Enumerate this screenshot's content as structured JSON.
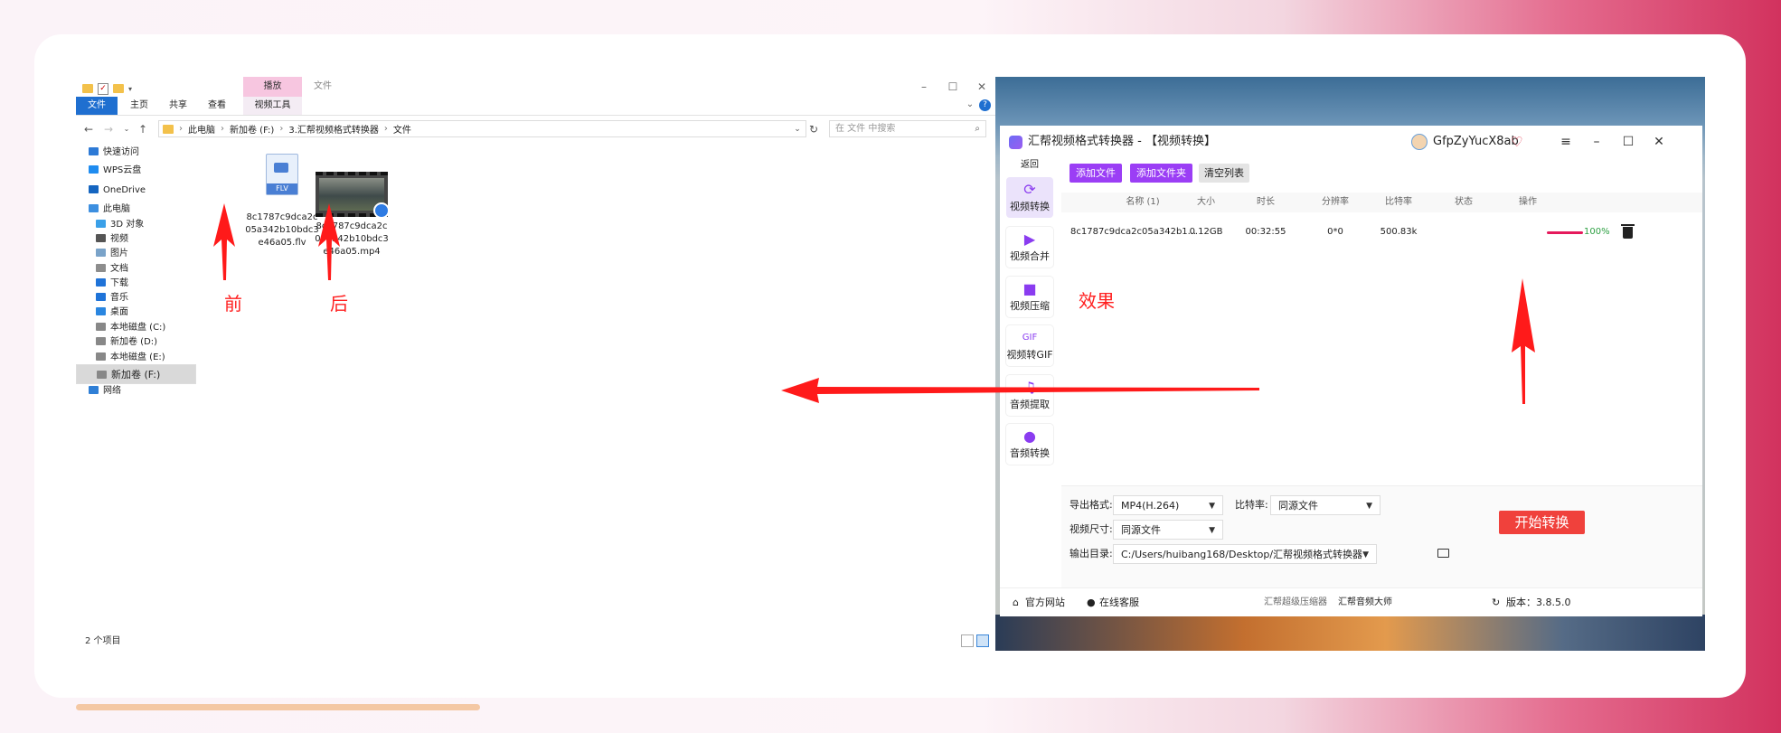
{
  "explorer": {
    "ribbon_tool_tab": "播放",
    "title": "文件",
    "ribbon_tabs": [
      "文件",
      "主页",
      "共享",
      "查看",
      "视频工具"
    ],
    "breadcrumb": [
      "此电脑",
      "新加卷 (F:)",
      "3.汇帮视频格式转换器",
      "文件"
    ],
    "search_placeholder": "在 文件 中搜索",
    "nav_items": [
      {
        "label": "快速访问",
        "icon": "star-icon",
        "color": "#2d7ad6"
      },
      {
        "label": "WPS云盘",
        "icon": "cloud-icon",
        "color": "#1f8cf0"
      },
      {
        "label": "OneDrive",
        "icon": "cloud-icon",
        "color": "#1565c0"
      },
      {
        "label": "此电脑",
        "icon": "computer-icon",
        "color": "#3d8fe0"
      },
      {
        "label": "3D 对象",
        "icon": "cube-icon",
        "color": "#3aa0e8"
      },
      {
        "label": "视频",
        "icon": "film-icon",
        "color": "#555555"
      },
      {
        "label": "图片",
        "icon": "picture-icon",
        "color": "#7aa3c9"
      },
      {
        "label": "文档",
        "icon": "document-icon",
        "color": "#8d8d8d"
      },
      {
        "label": "下载",
        "icon": "download-icon",
        "color": "#1f73d8"
      },
      {
        "label": "音乐",
        "icon": "music-icon",
        "color": "#1f73d8"
      },
      {
        "label": "桌面",
        "icon": "desktop-icon",
        "color": "#2a86e0"
      },
      {
        "label": "本地磁盘 (C:)",
        "icon": "drive-icon",
        "color": "#888888"
      },
      {
        "label": "新加卷 (D:)",
        "icon": "drive-icon",
        "color": "#888888"
      },
      {
        "label": "本地磁盘 (E:)",
        "icon": "drive-icon",
        "color": "#888888"
      },
      {
        "label": "新加卷 (F:)",
        "icon": "drive-icon",
        "color": "#888888"
      },
      {
        "label": "网络",
        "icon": "network-icon",
        "color": "#2f7fd6"
      }
    ],
    "files": [
      {
        "name": "8c1787c9dca2c05a342b10bdc3e46a05.flv",
        "badge": "FLV"
      },
      {
        "name": "8c1787c9dca2c05a342b10bdc3e46a05.mp4"
      }
    ],
    "status": "2 个项目"
  },
  "annotations": {
    "before": "前",
    "after": "后",
    "effect": "效果"
  },
  "converter": {
    "title": "汇帮视频格式转换器 - 【视频转换】",
    "user": "GfpZyYucX8ab",
    "back": "返回",
    "sidebar": [
      "视频转换",
      "视频合并",
      "视频压缩",
      "视频转GIF",
      "音频提取",
      "音频转换"
    ],
    "toolbar": {
      "add_file": "添加文件",
      "add_folder": "添加文件夹",
      "clear": "清空列表"
    },
    "table_headers": [
      "名称 (1)",
      "大小",
      "时长",
      "分辨率",
      "比特率",
      "状态",
      "操作"
    ],
    "row": {
      "name": "8c1787c9dca2c05a342b1...",
      "size": "0.12GB",
      "duration": "00:32:55",
      "resolution": "0*0",
      "bitrate": "500.83k",
      "progress_percent": 100,
      "progress_label": "100%"
    },
    "settings": {
      "format_label": "导出格式:",
      "format_value": "MP4(H.264)",
      "bitrate_label": "比特率:",
      "bitrate_value": "同源文件",
      "size_label": "视频尺寸:",
      "size_value": "同源文件",
      "output_label": "输出目录:",
      "output_value": "C:/Users/huibang168/Desktop/汇帮视频格式转换器"
    },
    "start_label": "开始转换",
    "footer": {
      "website": "官方网站",
      "service": "在线客服",
      "link1": "汇帮超级压缩器",
      "link2": "汇帮音频大师",
      "version": "版本：3.8.5.0"
    },
    "colors": {
      "accent": "#9b3ef5",
      "start": "#f0413c",
      "progress": "#e51a5c",
      "arrow": "#ff1a1a"
    }
  }
}
